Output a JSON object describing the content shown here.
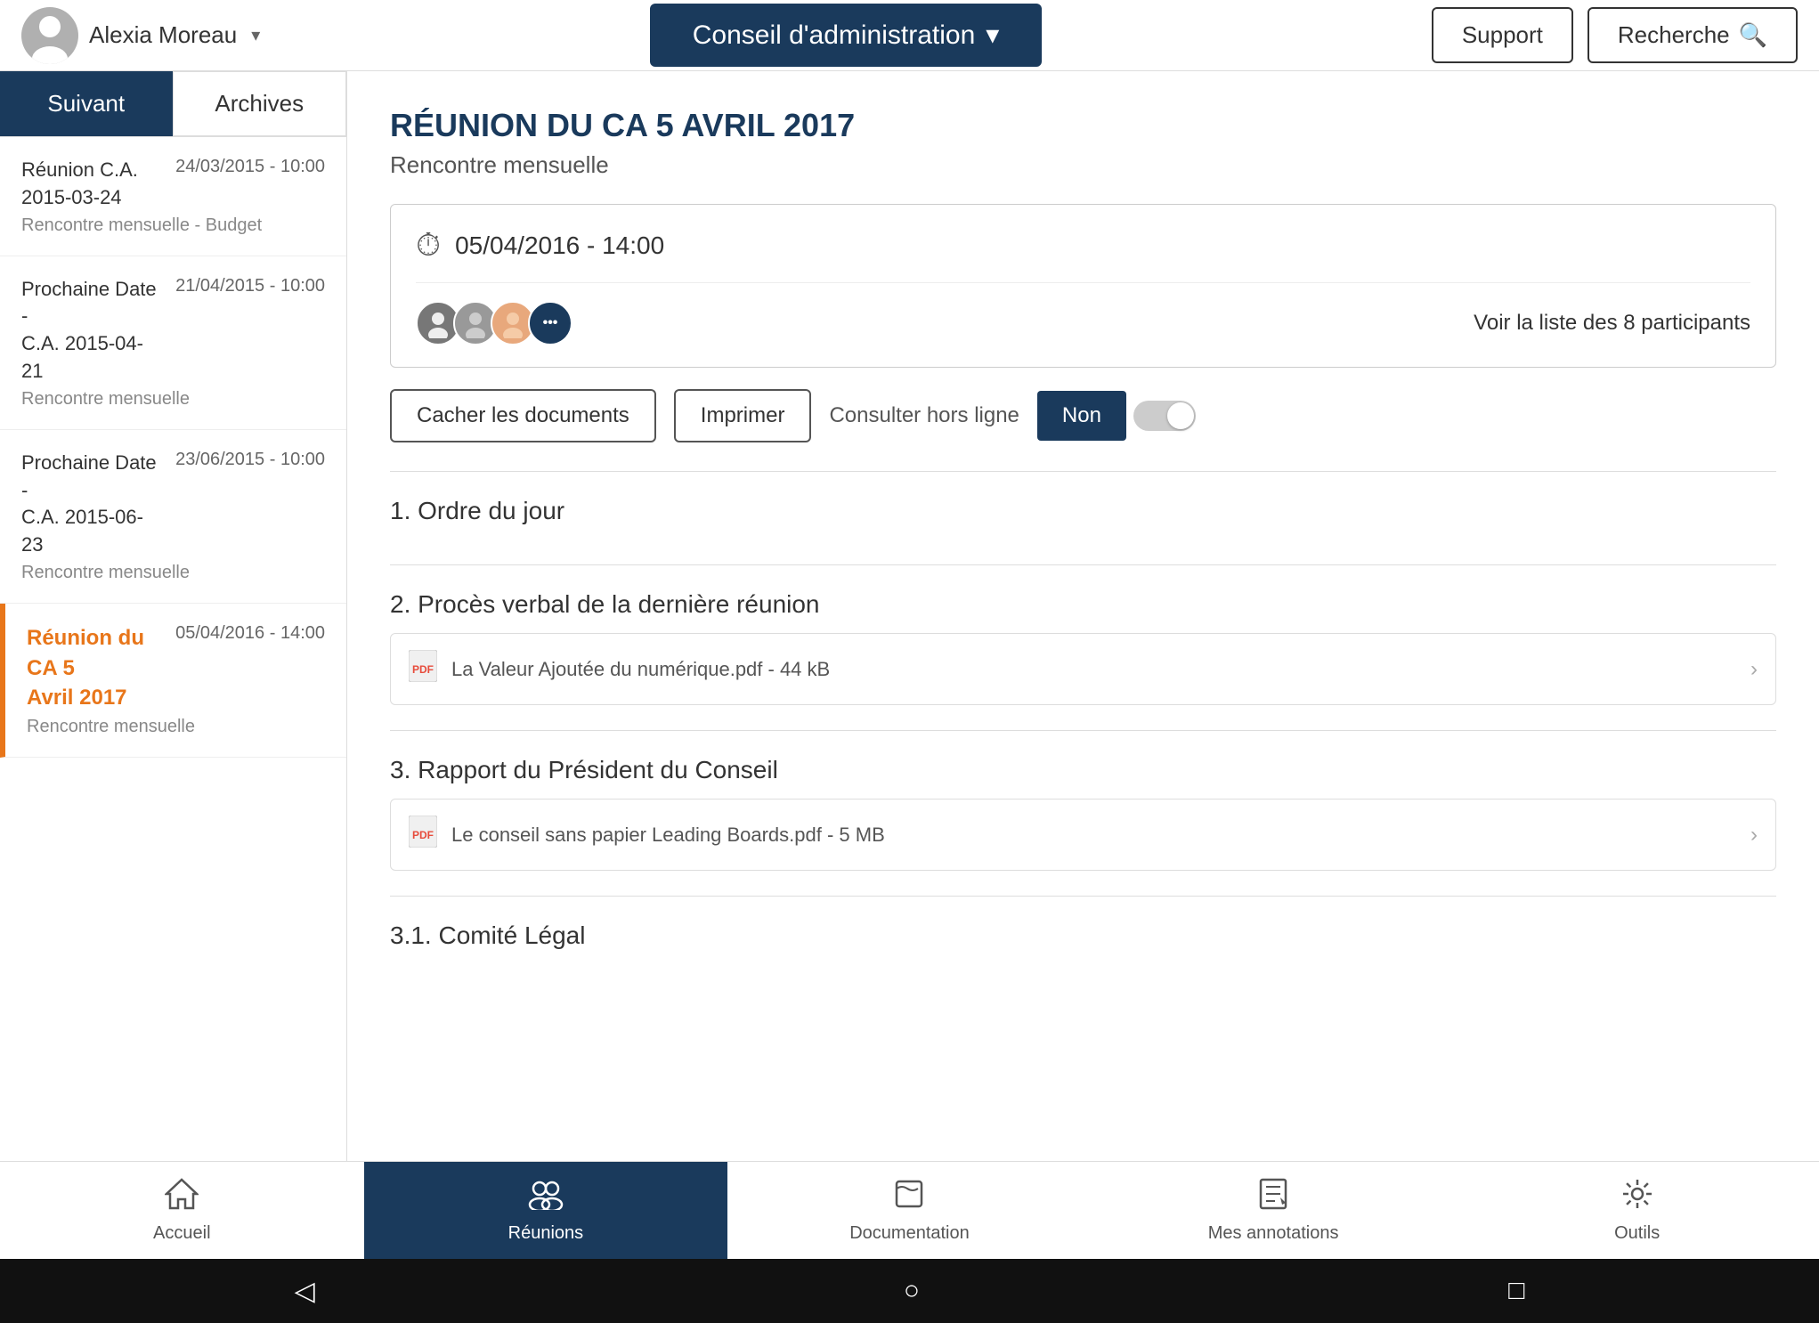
{
  "header": {
    "user_name": "Alexia Moreau",
    "dropdown_icon": "▾",
    "main_title": "Conseil d'administration",
    "main_title_dropdown": "▾",
    "support_label": "Support",
    "search_label": "Recherche",
    "search_icon": "🔍"
  },
  "sidebar": {
    "tab_suivant": "Suivant",
    "tab_archives": "Archives",
    "items": [
      {
        "id": "item-1",
        "title": "Réunion C.A. 2015-03-24",
        "date": "24/03/2015 - 10:00",
        "sub": "Rencontre mensuelle - Budget",
        "active": false
      },
      {
        "id": "item-2",
        "title": "Prochaine Date - C.A. 2015-04-21",
        "date": "21/04/2015 - 10:00",
        "sub": "Rencontre mensuelle",
        "active": false
      },
      {
        "id": "item-3",
        "title": "Prochaine Date - C.A. 2015-06-23",
        "date": "23/06/2015 - 10:00",
        "sub": "Rencontre mensuelle",
        "active": false
      },
      {
        "id": "item-4",
        "title": "Réunion du CA 5 Avril 2017",
        "date": "05/04/2016 - 14:00",
        "sub": "Rencontre mensuelle",
        "active": true
      }
    ]
  },
  "content": {
    "meeting_title": "RÉUNION DU CA 5 AVRIL 2017",
    "meeting_subtitle": "Rencontre mensuelle",
    "datetime": "05/04/2016 - 14:00",
    "participants_link": "Voir la liste des 8 participants",
    "participants_count": "8",
    "btn_cacher": "Cacher les documents",
    "btn_imprimer": "Imprimer",
    "offline_label": "Consulter hors ligne",
    "toggle_label": "Non",
    "agenda": [
      {
        "number": "1",
        "title": "1. Ordre du jour",
        "documents": []
      },
      {
        "number": "2",
        "title": "2. Procès verbal de la dernière réunion",
        "documents": [
          {
            "name": "La Valeur Ajoutée du numérique.pdf",
            "size": "44 kB"
          }
        ]
      },
      {
        "number": "3",
        "title": "3. Rapport du Président du Conseil",
        "documents": [
          {
            "name": "Le conseil sans papier Leading Boards.pdf",
            "size": "5 MB"
          }
        ]
      },
      {
        "number": "3.1",
        "title": "3.1. Comité Légal",
        "documents": []
      }
    ]
  },
  "bottom_nav": [
    {
      "id": "accueil",
      "label": "Accueil",
      "icon": "⌂",
      "active": false
    },
    {
      "id": "reunions",
      "label": "Réunions",
      "icon": "👥",
      "active": true
    },
    {
      "id": "documentation",
      "label": "Documentation",
      "icon": "📁",
      "active": false
    },
    {
      "id": "annotations",
      "label": "Mes annotations",
      "icon": "📋",
      "active": false
    },
    {
      "id": "outils",
      "label": "Outils",
      "icon": "⚙",
      "active": false
    }
  ],
  "android": {
    "back": "◁",
    "home": "○",
    "recent": "□"
  }
}
